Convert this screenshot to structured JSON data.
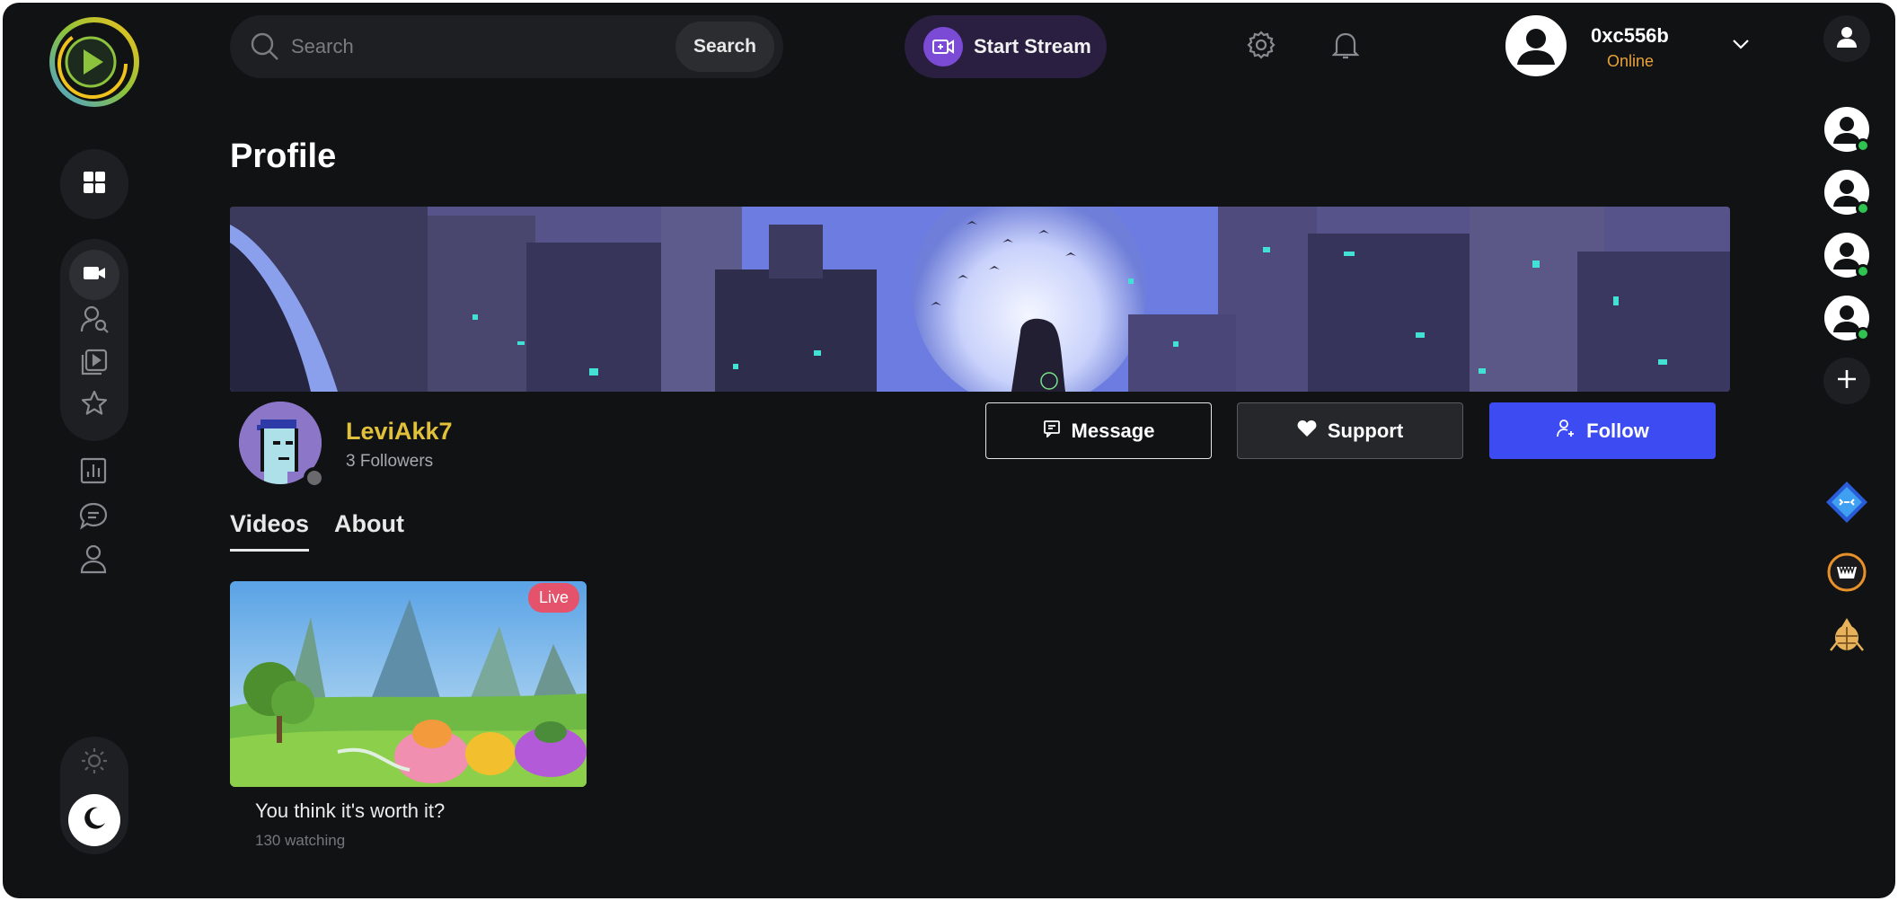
{
  "header": {
    "search": {
      "placeholder": "Search",
      "button_label": "Search"
    },
    "start_stream_label": "Start Stream",
    "user": {
      "name": "0xc556b",
      "status": "Online"
    }
  },
  "sidebar": {
    "items": [
      {
        "icon": "dashboard-icon"
      },
      {
        "icon": "video-camera-icon"
      },
      {
        "icon": "user-search-icon"
      },
      {
        "icon": "playlist-icon"
      },
      {
        "icon": "star-icon"
      },
      {
        "icon": "chart-icon"
      },
      {
        "icon": "chat-icon"
      },
      {
        "icon": "user-icon"
      }
    ],
    "theme": {
      "options": [
        "light",
        "dark"
      ],
      "active": "dark"
    }
  },
  "right_rail": {
    "friends_online": 4,
    "apps": [
      "diamond-app-icon",
      "fang-app-icon",
      "beetle-app-icon"
    ]
  },
  "page": {
    "title": "Profile",
    "profile": {
      "username": "LeviAkk7",
      "followers": "3 Followers"
    },
    "actions": {
      "message": "Message",
      "support": "Support",
      "follow": "Follow"
    },
    "tabs": [
      {
        "label": "Videos",
        "active": true
      },
      {
        "label": "About",
        "active": false
      }
    ],
    "videos": [
      {
        "title": "You think it's worth it?",
        "watching": "130 watching",
        "badge": "Live"
      }
    ]
  },
  "colors": {
    "background": "#111214",
    "panel": "#1e1f23",
    "accent_blue": "#3d4bf2",
    "accent_purple": "#7b4bd6",
    "username_gold": "#e2c13a",
    "status_orange": "#e8a23a",
    "live_red": "#e4536b",
    "online_green": "#2ec44f"
  }
}
